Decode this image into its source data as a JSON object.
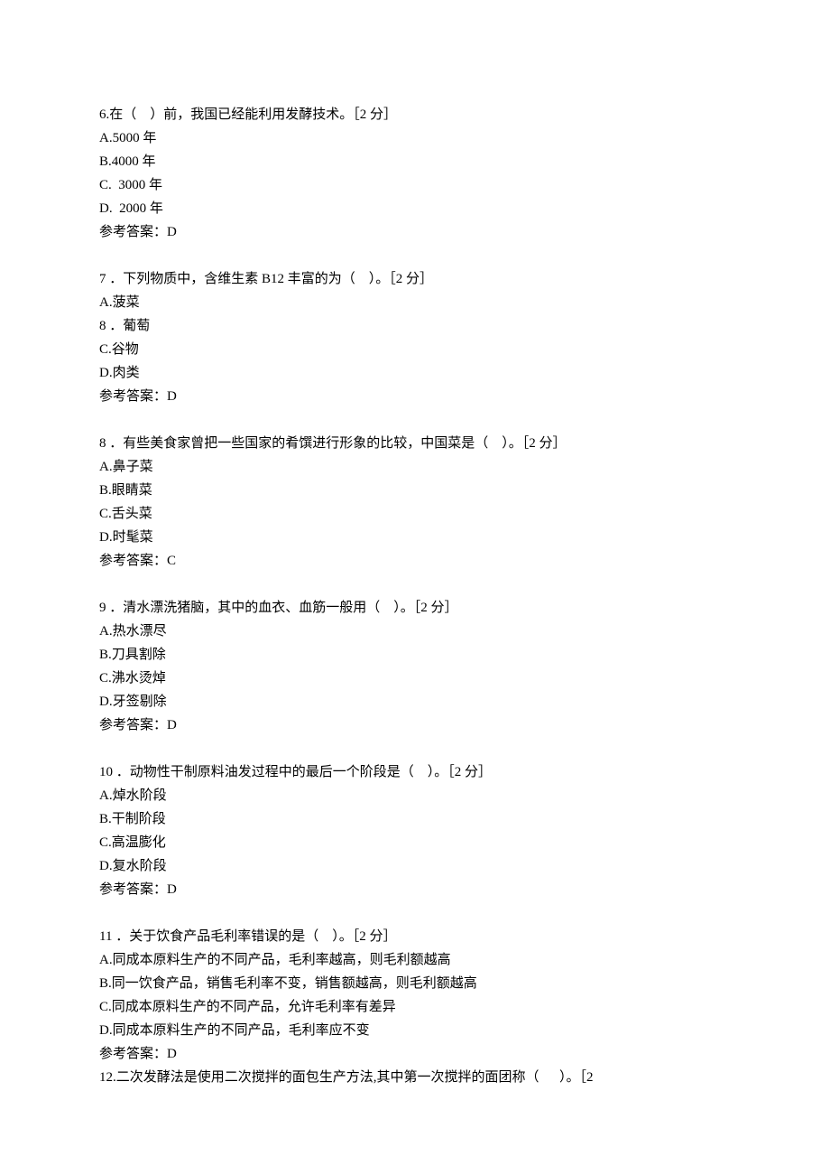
{
  "questions": [
    {
      "stem_prefix": "6.在（    ）前，我国已经能利用发酵技术。［2 分］",
      "options": [
        "A.5000 年",
        "B.4000 年",
        "C.  3000 年",
        "D.  2000 年"
      ],
      "answer": "参考答案：D"
    },
    {
      "stem_prefix": "7 ．下列物质中，含维生素 B12 丰富的为（    ）。［2 分］",
      "options": [
        "A.菠菜",
        "8 ．葡萄",
        "C.谷物",
        "D.肉类"
      ],
      "answer": "参考答案：D"
    },
    {
      "stem_prefix": "8 ．有些美食家曾把一些国家的肴馔进行形象的比较，中国菜是（    ）。［2 分］",
      "options": [
        "A.鼻子菜",
        "B.眼睛菜",
        "C.舌头菜",
        "D.时髦菜"
      ],
      "answer": "参考答案：C"
    },
    {
      "stem_prefix": "9 ．清水漂洗猪脑，其中的血衣、血筋一般用（    ）。［2 分］",
      "options": [
        "A.热水漂尽",
        "B.刀具割除",
        "C.沸水烫焯",
        "D.牙签剔除"
      ],
      "answer": "参考答案：D"
    },
    {
      "stem_prefix": "10 ．动物性干制原料油发过程中的最后一个阶段是（    ）。［2 分］",
      "options": [
        "A.焯水阶段",
        "B.干制阶段",
        "C.高温膨化",
        "D.复水阶段"
      ],
      "answer": "参考答案：D"
    },
    {
      "stem_prefix": "11 ．关于饮食产品毛利率错误的是（    ）。［2 分］",
      "options": [
        "A.同成本原料生产的不同产品，毛利率越高，则毛利额越高",
        "B.同一饮食产品，销售毛利率不变，销售额越高，则毛利额越高",
        "C.同成本原料生产的不同产品，允许毛利率有差异",
        "D.同成本原料生产的不同产品，毛利率应不变"
      ],
      "answer": "参考答案：D"
    }
  ],
  "trailing_line": "12.二次发酵法是使用二次搅拌的面包生产方法,其中第一次搅拌的面团称（      ）。［2"
}
